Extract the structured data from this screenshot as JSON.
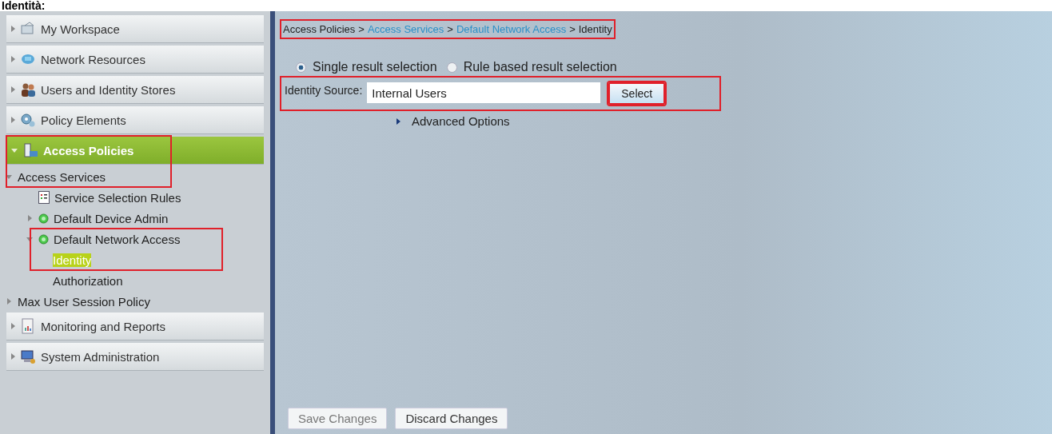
{
  "heading": "Identità:",
  "sidebar": {
    "sections": [
      {
        "label": "My Workspace",
        "kind": "workspace",
        "selected": false,
        "expanded": false,
        "highlighted": false
      },
      {
        "label": "Network Resources",
        "kind": "network",
        "selected": false,
        "expanded": false,
        "highlighted": false
      },
      {
        "label": "Users and Identity Stores",
        "kind": "users",
        "selected": false,
        "expanded": false,
        "highlighted": false
      },
      {
        "label": "Policy Elements",
        "kind": "policy",
        "selected": false,
        "expanded": false,
        "highlighted": false
      },
      {
        "label": "Access Policies",
        "kind": "access",
        "selected": true,
        "expanded": true,
        "highlighted": true,
        "tree": [
          {
            "label": "Access Services",
            "expanded": true,
            "selected": false,
            "children": [
              {
                "label": "Service Selection Rules",
                "kind": "rules",
                "selected": false
              },
              {
                "label": "Default Device Admin",
                "kind": "status",
                "expanded": false,
                "selected": false
              },
              {
                "label": "Default Network Access",
                "kind": "status",
                "expanded": true,
                "selected": false,
                "highlighted": true,
                "children": [
                  {
                    "label": "Identity",
                    "selected": true
                  },
                  {
                    "label": "Authorization",
                    "selected": false
                  }
                ]
              }
            ]
          },
          {
            "label": "Max User Session Policy",
            "expanded": false,
            "selected": false
          }
        ]
      },
      {
        "label": "Monitoring and Reports",
        "kind": "reports",
        "selected": false,
        "expanded": false,
        "highlighted": false
      },
      {
        "label": "System Administration",
        "kind": "admin",
        "selected": false,
        "expanded": false,
        "highlighted": false
      }
    ]
  },
  "breadcrumb": {
    "highlighted": true,
    "items": [
      {
        "label": "Access Policies",
        "link": false
      },
      {
        "label": "Access Services",
        "link": true
      },
      {
        "label": "Default Network Access",
        "link": true
      },
      {
        "label": "Identity",
        "link": false
      }
    ],
    "separator": ">"
  },
  "result_selection": [
    {
      "label": "Single result selection",
      "selected": true
    },
    {
      "label": "Rule based result selection",
      "selected": false
    }
  ],
  "identity_source": {
    "label": "Identity Source:",
    "value": "Internal Users",
    "highlighted": true,
    "button": {
      "label": "Select",
      "highlighted": true
    }
  },
  "advanced_options": {
    "label": "Advanced Options",
    "expanded": false
  },
  "footer_buttons": [
    {
      "label": "Save Changes",
      "disabled": true
    },
    {
      "label": "Discard Changes",
      "disabled": false
    }
  ]
}
